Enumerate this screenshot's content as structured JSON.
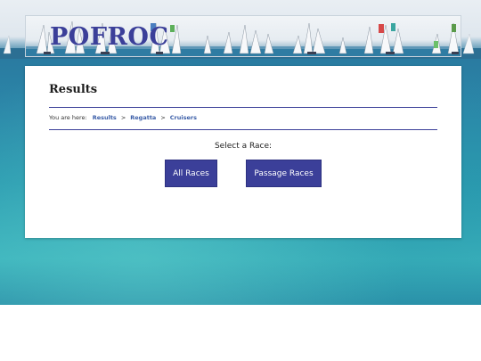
{
  "site": {
    "logo_text": "POFROC"
  },
  "page": {
    "title": "Results"
  },
  "breadcrumb": {
    "lead": "You are here:",
    "items": [
      "Results",
      "Regatta",
      "Cruisers"
    ],
    "separator": ">"
  },
  "race_selector": {
    "prompt": "Select a Race:",
    "buttons": [
      "All Races",
      "Passage Races"
    ]
  },
  "colors": {
    "brand": "#3b3f99",
    "link": "#3b5ea8"
  }
}
